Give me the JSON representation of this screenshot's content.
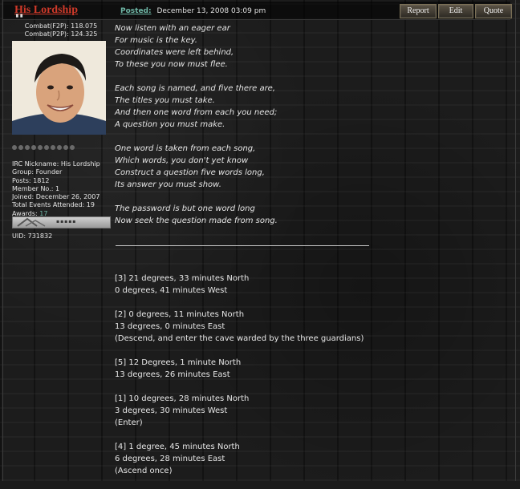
{
  "post": {
    "author": "His Lordship",
    "posted_label": "Posted:",
    "posted_date": "December 13, 2008 03:09 pm",
    "buttons": {
      "report": "Report",
      "edit": "Edit",
      "quote": "Quote"
    }
  },
  "profile": {
    "combat_f2p": "Combat(F2P): 118.075",
    "combat_p2p": "Combat(P2P): 124.325",
    "irc": "IRC Nickname: His Lordship",
    "group": "Group: Founder",
    "posts": "Posts: 1812",
    "member_no": "Member No.: 1",
    "joined": "Joined: December 26, 2007",
    "events": "Total Events Attended: 19",
    "awards_label": "Awards:",
    "awards_count": "17",
    "uid": "UID: 731832"
  },
  "poem": {
    "stanzas": [
      [
        "Now listen with an eager ear",
        "For music is the key.",
        "Coordinates were left behind,",
        "To these you now must flee."
      ],
      [
        "Each song is named, and five there are,",
        "The titles you must take.",
        "And then one word from each you need;",
        "A question you must make."
      ],
      [
        "One word is taken from each song,",
        "Which words, you don't yet know",
        "Construct a question five words long,",
        "Its answer you must show."
      ],
      [
        "The password is but one word long",
        "Now seek the question made from song."
      ]
    ]
  },
  "coordinates": [
    [
      "[3] 21 degrees, 33 minutes North",
      "0 degrees, 41 minutes West"
    ],
    [
      "[2] 0 degrees, 11 minutes North",
      "13 degrees, 0 minutes East",
      "(Descend, and enter the cave warded by the three guardians)"
    ],
    [
      "[5] 12 Degrees, 1 minute North",
      "13 degrees, 26 minutes East"
    ],
    [
      "[1] 10 degrees, 28 minutes North",
      "3 degrees, 30 minutes West",
      "(Enter)"
    ],
    [
      "[4] 1 degree, 45 minutes North",
      "6 degrees, 28 minutes East",
      "(Ascend once)"
    ]
  ]
}
